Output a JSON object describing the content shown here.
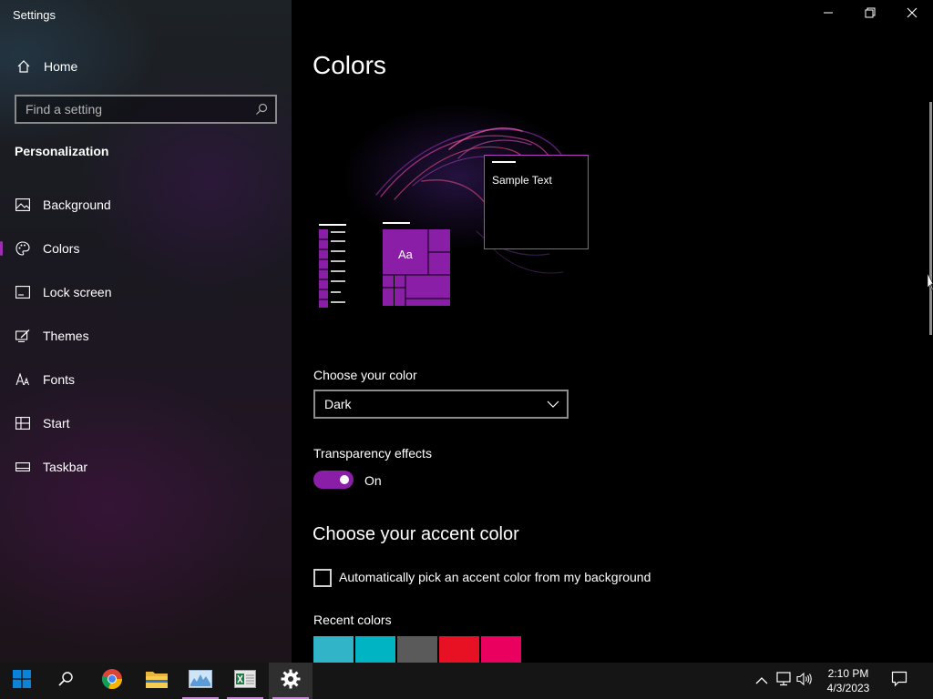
{
  "window": {
    "title": "Settings",
    "minimize_icon": "minimize-icon",
    "restore_icon": "restore-icon",
    "close_icon": "close-icon"
  },
  "sidebar": {
    "home_label": "Home",
    "search_placeholder": "Find a setting",
    "section_title": "Personalization",
    "items": [
      {
        "label": "Background",
        "icon": "image-icon"
      },
      {
        "label": "Colors",
        "icon": "palette-icon",
        "active": true
      },
      {
        "label": "Lock screen",
        "icon": "lock-screen-icon"
      },
      {
        "label": "Themes",
        "icon": "themes-icon"
      },
      {
        "label": "Fonts",
        "icon": "fonts-icon"
      },
      {
        "label": "Start",
        "icon": "start-icon"
      },
      {
        "label": "Taskbar",
        "icon": "taskbar-icon"
      }
    ]
  },
  "main": {
    "title": "Colors",
    "preview": {
      "sample_text": "Sample Text",
      "tile_text": "Aa",
      "accent_color": "#8a1ea6"
    },
    "choose_color": {
      "label": "Choose your color",
      "value": "Dark"
    },
    "transparency": {
      "label": "Transparency effects",
      "state": "On"
    },
    "accent_section": {
      "heading": "Choose your accent color",
      "auto_pick_label": "Automatically pick an accent color from my background",
      "auto_pick_checked": false,
      "recent_label": "Recent colors",
      "recent_colors": [
        "#31b4c7",
        "#00b4c4",
        "#5a5a5a",
        "#e81123",
        "#ea005e"
      ]
    }
  },
  "taskbar": {
    "apps": [
      "windows-start-icon",
      "search-icon",
      "chrome-icon",
      "file-explorer-icon",
      "resource-monitor-icon",
      "excel-icon",
      "settings-gear-icon"
    ],
    "tray": [
      "chevron-up-icon",
      "network-icon",
      "volume-icon",
      "notification-icon"
    ],
    "time": "2:10 PM",
    "date": "4/3/2023"
  }
}
